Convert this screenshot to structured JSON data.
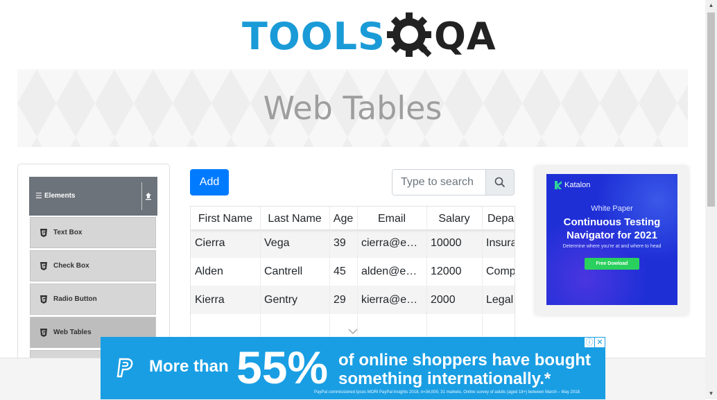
{
  "logo": {
    "part1": "TOOLS",
    "part2": "QA"
  },
  "page": {
    "title": "Web Tables"
  },
  "sidebar": {
    "group": "Elements",
    "items": [
      {
        "label": "Text Box",
        "active": false
      },
      {
        "label": "Check Box",
        "active": false
      },
      {
        "label": "Radio Button",
        "active": false
      },
      {
        "label": "Web Tables",
        "active": true
      }
    ]
  },
  "toolbar": {
    "add_label": "Add",
    "search_placeholder": "Type to search"
  },
  "table": {
    "headers": [
      "First Name",
      "Last Name",
      "Age",
      "Email",
      "Salary",
      "Department"
    ],
    "rows": [
      [
        "Cierra",
        "Vega",
        "39",
        "cierra@example.com",
        "10000",
        "Insurance"
      ],
      [
        "Alden",
        "Cantrell",
        "45",
        "alden@example.com",
        "12000",
        "Compliance"
      ],
      [
        "Kierra",
        "Gentry",
        "29",
        "kierra@example.com",
        "2000",
        "Legal"
      ]
    ]
  },
  "ad_side": {
    "brand": "Katalon",
    "kicker": "White Paper",
    "title_line1": "Continuous Testing",
    "title_line2": "Navigator for 2021",
    "subtitle": "Determine where you're at and where to head",
    "cta": "Free Dowload"
  },
  "ad_bottom": {
    "lead": "More than",
    "percent": "55%",
    "line1": "of online shoppers have bought",
    "line2": "something internationally.*",
    "fine_print": "PayPal commissioned Ipsos MORI PayPal Insights 2018, n=34,000, 31 markets. Online survey of adults (aged 18+) between March – May 2018."
  },
  "colors": {
    "primary": "#007bff",
    "logo_blue": "#1a9bd7",
    "ad_blue": "#199ee3",
    "katalon_blue": "#1e2fd6",
    "cta_green": "#2ad05d"
  }
}
